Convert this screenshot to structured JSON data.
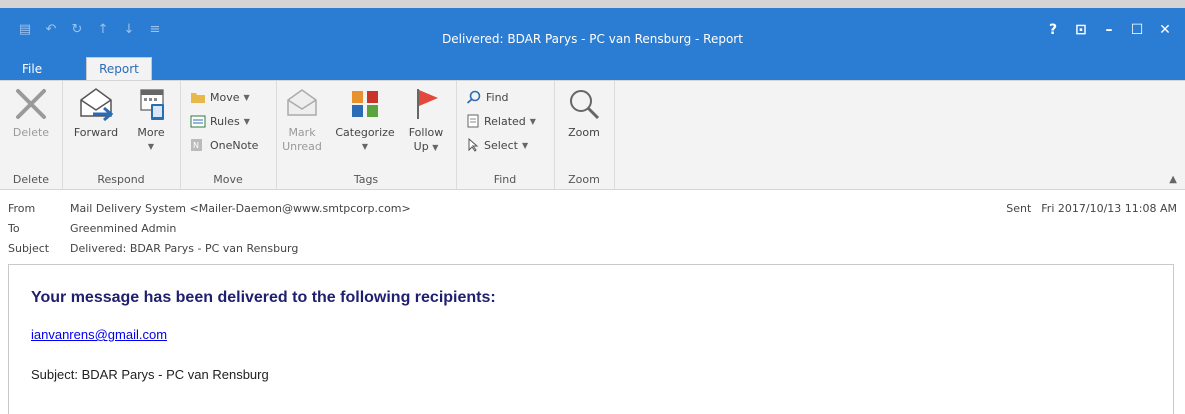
{
  "window": {
    "title": "Delivered: BDAR Parys - PC van Rensburg - Report",
    "qat_icons": [
      "save-icon",
      "undo-icon",
      "redo-icon",
      "up-arrow-icon",
      "down-arrow-icon",
      "customize-icon"
    ],
    "controls": [
      "?",
      "⊡",
      "–",
      "☐",
      "✕"
    ]
  },
  "tabs": [
    {
      "label": "File"
    },
    {
      "label": "Report"
    }
  ],
  "ribbon": {
    "delete": {
      "group": "Delete",
      "delete_label": "Delete"
    },
    "respond": {
      "group": "Respond",
      "forward_label": "Forward",
      "more_label": "More"
    },
    "move": {
      "group": "Move",
      "move_label": "Move",
      "rules_label": "Rules",
      "onenote_label": "OneNote"
    },
    "tags": {
      "group": "Tags",
      "mark_unread_line1": "Mark",
      "mark_unread_line2": "Unread",
      "categorize_label": "Categorize",
      "follow_up_line1": "Follow",
      "follow_up_line2": "Up"
    },
    "find": {
      "group": "Find",
      "find_label": "Find",
      "related_label": "Related",
      "select_label": "Select"
    },
    "zoom": {
      "group": "Zoom",
      "zoom_label": "Zoom"
    }
  },
  "headers": {
    "from_label": "From",
    "from_value": "Mail Delivery System <Mailer-Daemon@www.smtpcorp.com>",
    "to_label": "To",
    "to_value": "Greenmined Admin",
    "subject_label": "Subject",
    "subject_value": "Delivered: BDAR Parys - PC van Rensburg",
    "sent_label": "Sent",
    "sent_value": "Fri 2017/10/13 11:08 AM"
  },
  "message": {
    "heading": "Your message has been delivered to the following recipients:",
    "recipient": "ianvanrens@gmail.com",
    "subject_line": "Subject: BDAR Parys - PC van Rensburg"
  }
}
